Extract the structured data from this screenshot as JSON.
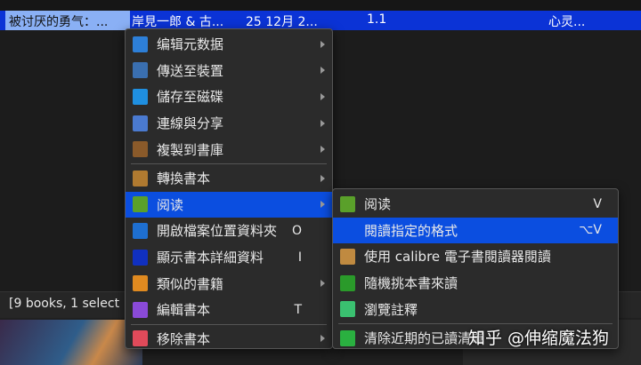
{
  "book_row": {
    "title": "被讨厌的勇气：...",
    "author": "岸見一郎 & 古...",
    "date": "25 12月 2...",
    "version": "1.1",
    "tags": "心灵..."
  },
  "status": "[9 books, 1 select",
  "menu": [
    {
      "label": "编辑元数据",
      "shortcut": "",
      "submenu": true,
      "icon": "edit-metadata-icon",
      "color": "#2d7fd8"
    },
    {
      "label": "傳送至裝置",
      "shortcut": "",
      "submenu": true,
      "icon": "send-to-device-icon",
      "color": "#3a6fb0"
    },
    {
      "label": "儲存至磁碟",
      "shortcut": "",
      "submenu": true,
      "icon": "save-to-disk-icon",
      "color": "#1f8fe0"
    },
    {
      "label": "連線與分享",
      "shortcut": "",
      "submenu": true,
      "icon": "connect-share-icon",
      "color": "#4a7ad0"
    },
    {
      "label": "複製到書庫",
      "shortcut": "",
      "submenu": true,
      "icon": "copy-to-library-icon",
      "color": "#8a5a2a"
    },
    {
      "label": "轉換書本",
      "shortcut": "",
      "submenu": true,
      "icon": "convert-book-icon",
      "color": "#b07a30"
    },
    {
      "label": "阅读",
      "shortcut": "",
      "submenu": true,
      "icon": "read-book-icon",
      "color": "#5aa02a"
    },
    {
      "label": "開啟檔案位置資料夾",
      "shortcut": "O",
      "submenu": false,
      "icon": "open-folder-icon",
      "color": "#1e6fd0"
    },
    {
      "label": "顯示書本詳細資料",
      "shortcut": "I",
      "submenu": false,
      "icon": "info-icon",
      "color": "#1030c0"
    },
    {
      "label": "類似的書籍",
      "shortcut": "",
      "submenu": true,
      "icon": "similar-books-icon",
      "color": "#e08a20"
    },
    {
      "label": "編輯書本",
      "shortcut": "T",
      "submenu": false,
      "icon": "edit-book-icon",
      "color": "#8a4ad8"
    },
    {
      "label": "移除書本",
      "shortcut": "",
      "submenu": true,
      "icon": "remove-book-icon",
      "color": "#e04a5a"
    }
  ],
  "submenu": [
    {
      "label": "阅读",
      "shortcut": "V",
      "icon": "read-book-icon",
      "color": "#5aa02a"
    },
    {
      "label": "閱讀指定的格式",
      "shortcut": "⌥V",
      "icon": "",
      "color": ""
    },
    {
      "label": "使用 calibre 電子書閱讀器閱讀",
      "shortcut": "",
      "icon": "calibre-viewer-icon",
      "color": "#c08a40"
    },
    {
      "label": "隨機挑本書來讀",
      "shortcut": "",
      "icon": "random-dice-icon",
      "color": "#2a9a2a"
    },
    {
      "label": "瀏覽註釋",
      "shortcut": "",
      "icon": "highlighter-icon",
      "color": "#3ac070"
    },
    {
      "label": "清除近期的已讀清單",
      "shortcut": "",
      "icon": "recycle-icon",
      "color": "#2ab040"
    }
  ],
  "watermark": "知乎 @伸缩魔法狗"
}
